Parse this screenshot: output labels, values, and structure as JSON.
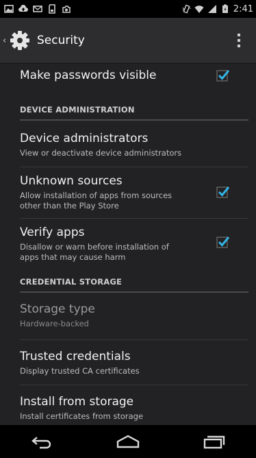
{
  "status_bar": {
    "time": "2:41",
    "left_icons": [
      "gallery-icon",
      "cloud-upload-icon",
      "mail-icon",
      "sd-card-icon",
      "camera-icon"
    ],
    "right_icons": [
      "vibrate-icon",
      "wifi-icon",
      "signal-icon",
      "battery-icon"
    ]
  },
  "action_bar": {
    "title": "Security",
    "up_icon": "chevron-left-icon",
    "app_icon": "gear-icon",
    "overflow_icon": "overflow-menu-icon"
  },
  "preferences": {
    "make_passwords_visible": {
      "title": "Make passwords visible",
      "checked": true
    },
    "device_admin_header": "DEVICE ADMINISTRATION",
    "device_administrators": {
      "title": "Device administrators",
      "summary": "View or deactivate device administrators"
    },
    "unknown_sources": {
      "title": "Unknown sources",
      "summary_line1": "Allow installation of apps from sources",
      "summary_line2": "other than the Play Store",
      "checked": true
    },
    "verify_apps": {
      "title": "Verify apps",
      "summary_line1": "Disallow or warn before installation of",
      "summary_line2": "apps that may cause harm",
      "checked": true
    },
    "credential_storage_header": "CREDENTIAL STORAGE",
    "storage_type": {
      "title": "Storage type",
      "summary": "Hardware-backed",
      "enabled": false
    },
    "trusted_credentials": {
      "title": "Trusted credentials",
      "summary": "Display trusted CA certificates"
    },
    "install_from_storage": {
      "title": "Install from storage",
      "summary": "Install certificates from storage"
    }
  },
  "nav_bar": {
    "buttons": [
      "back-icon",
      "home-icon",
      "recents-icon"
    ]
  },
  "colors": {
    "accent": "#33b5e5",
    "background": "#222224",
    "action_bar": "#2d2d2f"
  }
}
